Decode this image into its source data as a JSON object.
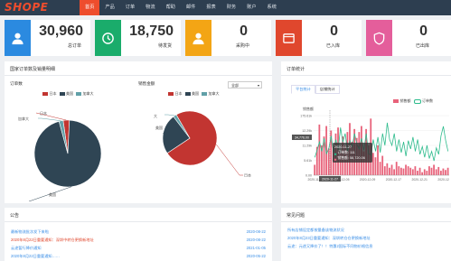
{
  "brand": {
    "logo_text": "SHOPE",
    "accent": "#ee4d2d"
  },
  "nav": [
    "首页",
    "产品",
    "订单",
    "物流",
    "帮助",
    "邮件",
    "报表",
    "财务",
    "账户",
    "系统"
  ],
  "stats": [
    {
      "value": "30,960",
      "label": "总订单",
      "color": "#2b8ae0",
      "icon": "user-icon"
    },
    {
      "value": "18,750",
      "label": "待发货",
      "color": "#1aac6b",
      "icon": "clock-icon"
    },
    {
      "value": "0",
      "label": "采购中",
      "color": "#f3a515",
      "icon": "user-icon"
    },
    {
      "value": "0",
      "label": "已入库",
      "color": "#e0472d",
      "icon": "box-icon"
    },
    {
      "value": "0",
      "label": "已出库",
      "color": "#e45e9b",
      "icon": "shield-icon"
    }
  ],
  "left_panel": {
    "title": "国家订单数及销量明细",
    "orders_label": "订单数",
    "sales_label": "销售金额",
    "select_value": "全部",
    "legend": [
      {
        "name": "日本",
        "color": "#c23531"
      },
      {
        "name": "美国",
        "color": "#2f4554"
      },
      {
        "name": "加拿大",
        "color": "#61a0a8"
      }
    ]
  },
  "right_panel": {
    "title": "订单统计",
    "tabs": [
      "平台统计",
      "店铺统计"
    ],
    "legend": [
      {
        "name": "销售额",
        "color": "#e8627a"
      },
      {
        "name": "订单数",
        "color": "#2dbb8c"
      }
    ],
    "tooltip": {
      "date": "2020-11-27",
      "orders": "订单数: 111",
      "sales": "销售额: 58,720.06"
    },
    "pointer_y_label": "34,776.00",
    "pointer_x_label": "2020-11-27"
  },
  "chart_data": [
    {
      "type": "pie",
      "title": "订单数",
      "categories": [
        "日本",
        "美国",
        "加拿大"
      ],
      "values": [
        3,
        95,
        2
      ],
      "slice_labels": [
        "日本",
        "美国",
        "加拿大"
      ]
    },
    {
      "type": "pie",
      "title": "销售金额",
      "categories": [
        "日本",
        "美国",
        "加拿大"
      ],
      "values": [
        74,
        24,
        2
      ],
      "slice_labels": [
        "日本",
        "美国",
        "加拿大"
      ]
    },
    {
      "type": "bar",
      "xlabel": "",
      "ylabel": "",
      "y_label_top": "销售额",
      "yticks": [
        "175.61k",
        "12.29k",
        "11.29k",
        "5.61k",
        "0.00"
      ],
      "xticks": [
        "2020-11-27",
        "2020-12-05",
        "2020-12-09",
        "2020-12-17",
        "2020-12-21",
        "2020-12-25"
      ],
      "series": [
        {
          "name": "销售额",
          "values": [
            14,
            38,
            68,
            40,
            52,
            66,
            36,
            60,
            38,
            56,
            64,
            30,
            52,
            40,
            58,
            70,
            45,
            62,
            50,
            58,
            66,
            32,
            62,
            40,
            76,
            30,
            24,
            40,
            18,
            26,
            12,
            16,
            10,
            14,
            8,
            18,
            12,
            10,
            9,
            14,
            12,
            10,
            8,
            12,
            6,
            10,
            4,
            8,
            6,
            12,
            10,
            14,
            8,
            11,
            6,
            9,
            7,
            10
          ]
        },
        {
          "name": "订单数",
          "values": [
            30,
            42,
            56,
            40,
            62,
            36,
            45,
            66,
            38,
            60,
            42,
            80,
            55,
            70,
            40,
            58,
            48,
            70,
            52,
            44,
            62,
            42,
            70,
            36,
            34,
            60,
            40,
            64,
            38,
            70,
            50,
            88,
            60,
            50,
            70,
            40,
            60,
            38,
            56,
            32,
            58,
            44,
            64,
            40,
            60,
            35,
            48,
            30,
            50,
            28,
            40,
            24,
            46,
            35,
            66,
            82,
            58,
            40
          ]
        }
      ]
    }
  ],
  "announcements": {
    "title": "公告",
    "items": [
      {
        "text": "最新物流批次发下来啦",
        "date": "2020-08-22",
        "color": "#3a8ee6"
      },
      {
        "text": "2020年8月22日重要通知：深圳中转仓更换新地址",
        "date": "2020-08-22",
        "color": "#e0472d"
      },
      {
        "text": "云途暂行降价通知",
        "date": "2021-01-05",
        "color": "#3a8ee6"
      },
      {
        "text": "2020年8月22日重要通知……",
        "date": "2020-05-22",
        "color": "#3a8ee6"
      }
    ]
  },
  "faq": {
    "title": "常见问题",
    "items": [
      "所有店铺设定都按量备该物流状况",
      "2020年8月23日重要通知：深圳转仓仓更换新地址",
      "云途：元途又降价了！！特惠2国际不同物价格信息"
    ]
  }
}
